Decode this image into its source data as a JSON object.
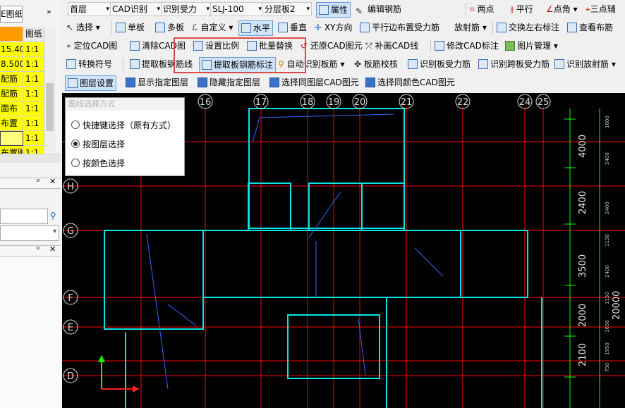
{
  "left_panel": {
    "tab_label": "E图纸",
    "more": "»",
    "grid_header": [
      "",
      "图纸"
    ],
    "rows": [
      {
        "name": "15.40",
        "scale": "1:1"
      },
      {
        "name": "8.500",
        "scale": "1:1"
      },
      {
        "name": "配筋",
        "scale": "1:1"
      },
      {
        "name": "配筋",
        "scale": "1:1"
      },
      {
        "name": "面布",
        "scale": "1:1"
      },
      {
        "name": "布置",
        "scale": "1:1"
      },
      {
        "name": "",
        "scale": "1:1"
      },
      {
        "name": "布置图",
        "scale": "1:1"
      }
    ],
    "pin_glyph": "ᵖ",
    "close_glyph": "✕",
    "search_icon": "search-icon",
    "search_glyph": "⚲"
  },
  "toolbar1": {
    "floor": "首层",
    "cad_recognize": "CAD识别",
    "recognize_force": "识别受力",
    "component": "SLJ-100",
    "layer_board": "分层板2",
    "properties": "属性",
    "edit_rebar": "编辑钢筋",
    "two_points": "两点",
    "parallel": "平行",
    "point_angle": "点角",
    "three_point_axis": "三点辅"
  },
  "toolbar2": {
    "select": "选择",
    "single_board": "单板",
    "multi_board": "多板",
    "custom": "自定义",
    "horizontal": "水平",
    "vertical": "垂直",
    "xy_direction": "XY方向",
    "parallel_edge": "平行边布置受力筋",
    "radial": "放射筋",
    "cross_left_right": "交换左右标注",
    "view_layout": "查看布筋"
  },
  "toolbar3": {
    "locate_cad": "定位CAD图",
    "clear_cad": "清除CAD图",
    "set_scale": "设置比例",
    "batch_replace": "批量替换",
    "restore_cad": "还原CAD图元",
    "patch_cad_line": "补画CAD线",
    "modify_cad_label": "修改CAD标注",
    "image_manage": "图片管理"
  },
  "toolbar4": {
    "convert_symbol": "转换符号",
    "extract_rebar_line": "提取板钢筋线",
    "extract_rebar_label": "提取板钢筋标注",
    "auto_recognize": "自动识别板筋",
    "rebar_check": "板筋校核",
    "recognize_force": "识别板受力筋",
    "recognize_span_force": "识别跨板受力筋",
    "recognize_radial": "识别放射筋"
  },
  "toolbar5": {
    "layer_settings": "图层设置",
    "show_layer": "显示指定图层",
    "hide_layer": "隐藏指定图层",
    "select_same_layer": "选择同图层CAD图元",
    "select_same_color": "选择同颜色CAD图元"
  },
  "popup": {
    "title": "图线选择方式",
    "options": [
      "快捷键选择（原有方式）",
      "按图层选择",
      "按颜色选择"
    ],
    "selected_index": 1
  },
  "drawing": {
    "axis_numbers": [
      "16",
      "17",
      "18",
      "19",
      "20",
      "21",
      "22",
      "24",
      "25"
    ],
    "axis_letters": [
      "H",
      "G",
      "F",
      "E",
      "D"
    ],
    "dims_right": [
      "4000",
      "2400",
      "3500",
      "20000",
      "2000",
      "2100"
    ],
    "dims_small": [
      "1600",
      "2400",
      "2400",
      "1130",
      "2400",
      "1150",
      "1650",
      "1950",
      "750"
    ],
    "colors": {
      "grid": "#ff0000",
      "wall": "#00e5e5",
      "dim": "#00ff00",
      "rebar": "#3366ff",
      "axis_circle": "#e0e0e0"
    }
  }
}
